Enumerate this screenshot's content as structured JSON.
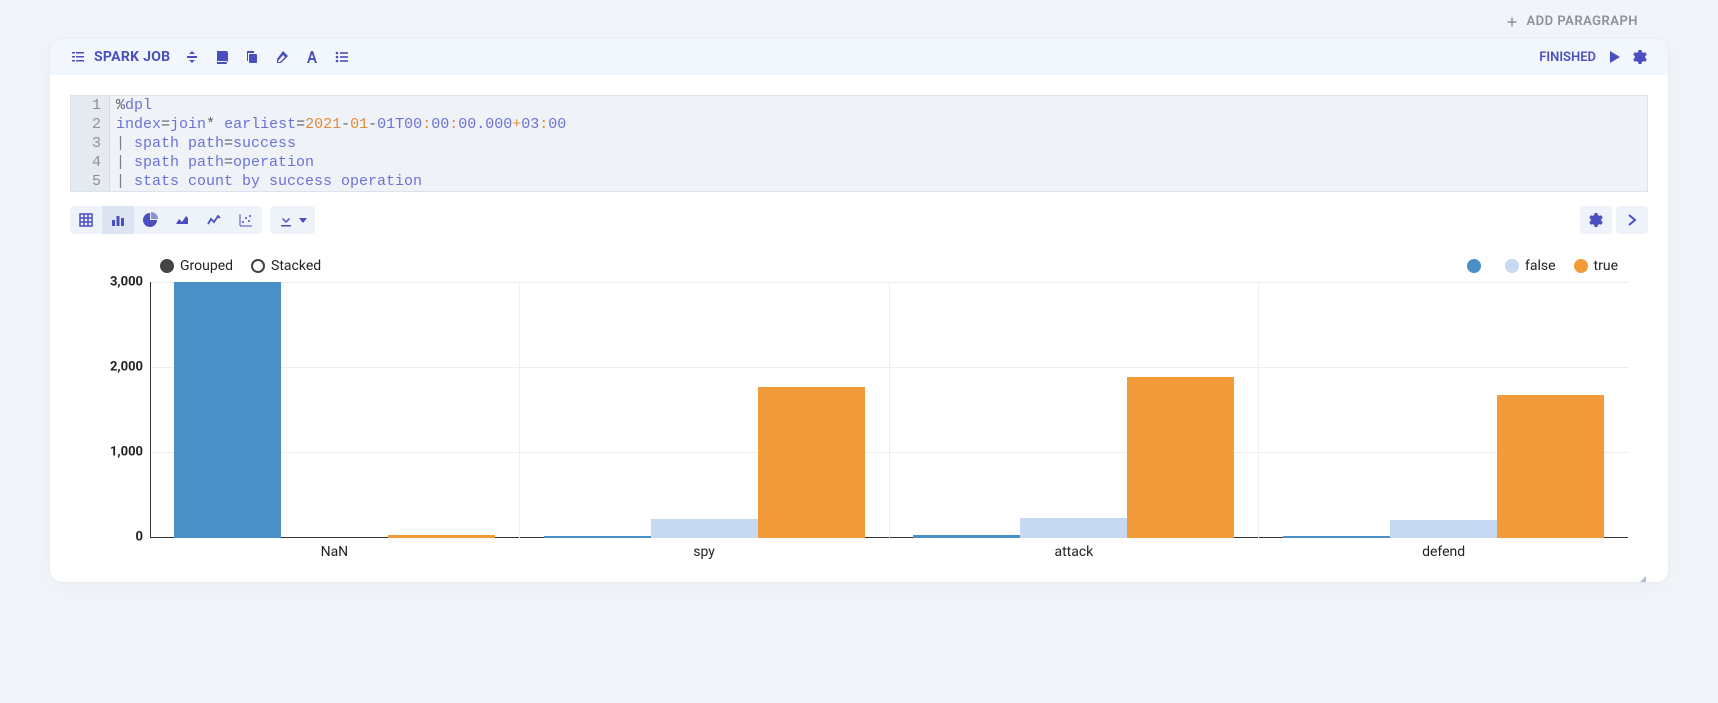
{
  "add_paragraph_label": "ADD PARAGRAPH",
  "header": {
    "title": "SPARK JOB",
    "status": "FINISHED"
  },
  "code": {
    "gutter": [
      "1",
      "2",
      "3",
      "4",
      "5"
    ],
    "lines": [
      {
        "segments": [
          {
            "t": "%",
            "c": "tk-pct"
          },
          {
            "t": "dpl",
            "c": "tk-kw"
          }
        ]
      },
      {
        "segments": [
          {
            "t": "index",
            "c": "tk-kw"
          },
          {
            "t": "=",
            "c": "tk-op"
          },
          {
            "t": "join",
            "c": "tk-kw"
          },
          {
            "t": "* ",
            "c": "tk-plain"
          },
          {
            "t": "earliest",
            "c": "tk-kw"
          },
          {
            "t": "=",
            "c": "tk-op"
          },
          {
            "t": "2021",
            "c": "tk-num"
          },
          {
            "t": "-",
            "c": "tk-plain"
          },
          {
            "t": "01",
            "c": "tk-num"
          },
          {
            "t": "-",
            "c": "tk-plain"
          },
          {
            "t": "01",
            "c": "tk-kw"
          },
          {
            "t": "T00",
            "c": "tk-kw"
          },
          {
            "t": ":",
            "c": "tk-num"
          },
          {
            "t": "00",
            "c": "tk-kw"
          },
          {
            "t": ":",
            "c": "tk-num"
          },
          {
            "t": "00.000",
            "c": "tk-kw"
          },
          {
            "t": "+",
            "c": "tk-num"
          },
          {
            "t": "03",
            "c": "tk-kw"
          },
          {
            "t": ":",
            "c": "tk-num"
          },
          {
            "t": "00",
            "c": "tk-kw"
          }
        ]
      },
      {
        "segments": [
          {
            "t": "| ",
            "c": "tk-pipe"
          },
          {
            "t": "spath path",
            "c": "tk-kw"
          },
          {
            "t": "=",
            "c": "tk-op"
          },
          {
            "t": "success",
            "c": "tk-kw"
          }
        ]
      },
      {
        "segments": [
          {
            "t": "| ",
            "c": "tk-pipe"
          },
          {
            "t": "spath path",
            "c": "tk-kw"
          },
          {
            "t": "=",
            "c": "tk-op"
          },
          {
            "t": "operation",
            "c": "tk-kw"
          }
        ]
      },
      {
        "segments": [
          {
            "t": "| ",
            "c": "tk-pipe"
          },
          {
            "t": "stats count by success operation",
            "c": "tk-kw"
          }
        ]
      }
    ]
  },
  "chart_controls": {
    "mode_grouped": "Grouped",
    "mode_stacked": "Stacked",
    "selected_mode": "Grouped"
  },
  "legend": {
    "items": [
      {
        "label": "",
        "color": "#4a90c7"
      },
      {
        "label": "false",
        "color": "#c7d8f2"
      },
      {
        "label": "true",
        "color": "#f39b3b"
      }
    ]
  },
  "chart_data": {
    "type": "bar",
    "categories": [
      "NaN",
      "spy",
      "attack",
      "defend"
    ],
    "series": [
      {
        "name": "",
        "color": "#4a90c7",
        "values": [
          3000,
          20,
          30,
          20
        ]
      },
      {
        "name": "false",
        "color": "#c7d8f2",
        "values": [
          0,
          220,
          230,
          210
        ]
      },
      {
        "name": "true",
        "color": "#f39b3b",
        "values": [
          30,
          1770,
          1890,
          1680
        ]
      }
    ],
    "ylim": [
      0,
      3000
    ],
    "yticks": [
      0,
      1000,
      2000,
      3000
    ],
    "ytick_labels": [
      "0",
      "1,000",
      "2,000",
      "3,000"
    ],
    "xlabel": "",
    "ylabel": "",
    "title": ""
  }
}
